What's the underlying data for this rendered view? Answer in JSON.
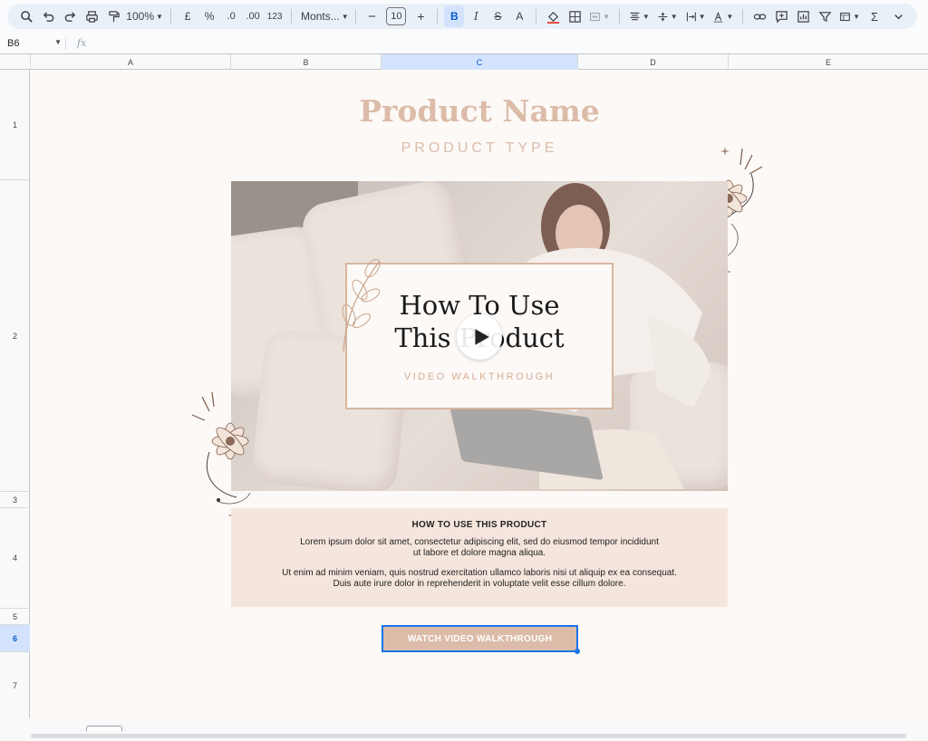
{
  "toolbar": {
    "zoom": "100%",
    "currency": "£",
    "percent": "%",
    "dec_decrease": ".0",
    "dec_increase": ".00",
    "number_format": "123",
    "font": "Monts...",
    "font_size": "10",
    "minus": "−",
    "plus": "+",
    "bold": "B",
    "italic": "I",
    "strike": "S",
    "text_color": "A",
    "sum": "Σ"
  },
  "formula_bar": {
    "cell_ref": "B6",
    "fx": "fx"
  },
  "columns": [
    "A",
    "B",
    "C",
    "D",
    "E"
  ],
  "selected_column": "C",
  "rows": [
    "1",
    "2",
    "3",
    "4",
    "5",
    "6",
    "7"
  ],
  "selected_row": "6",
  "page": {
    "title": "Product Name",
    "subtitle": "PRODUCT TYPE",
    "card": {
      "line1": "How To Use",
      "line2": "This Product",
      "sub": "VIDEO WALKTHROUGH"
    },
    "info": {
      "heading": "HOW TO USE THIS PRODUCT",
      "p1a": "Lorem ipsum dolor sit amet, consectetur adipiscing elit, sed do eiusmod tempor incididunt",
      "p1b": "ut labore et dolore magna aliqua.",
      "p2a": "Ut enim ad minim veniam, quis nostrud exercitation ullamco laboris nisi ut aliquip ex ea consequat.",
      "p2b": "Duis aute irure dolor in reprehenderit in voluptate velit esse cillum dolore."
    },
    "button": "WATCH VIDEO WALKTHROUGH"
  },
  "colors": {
    "accent": "#dcbca8",
    "info_bg": "#f5e6dd",
    "selection": "#1a73e8"
  }
}
